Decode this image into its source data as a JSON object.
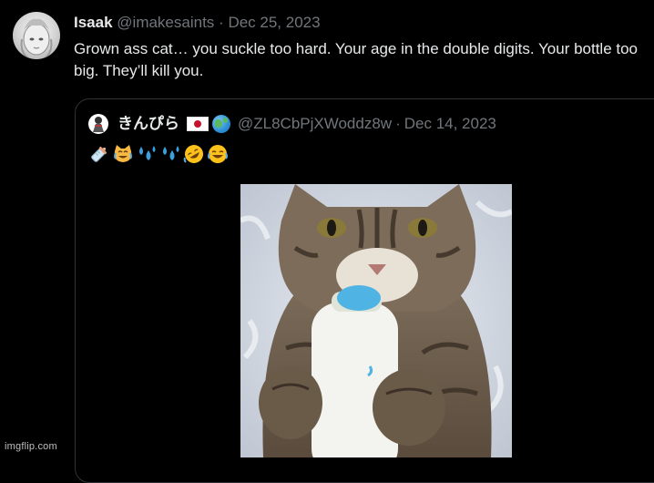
{
  "tweet": {
    "author_name": "Isaak",
    "handle": "@imakesaints",
    "separator": "·",
    "date": "Dec 25, 2023",
    "text": "Grown ass cat… you suckle too hard. Your age in the double digits. Your bottle too big. They’ll kill you."
  },
  "quoted_tweet": {
    "author_name": "きんぴら",
    "handle": "@ZL8CbPjXWoddz8w",
    "separator": "·",
    "date": "Dec 14, 2023",
    "emojis": [
      "baby-bottle",
      "joy-cat",
      "sweat-droplets",
      "sweat-droplets",
      "rofl",
      "joy"
    ],
    "media_description_icon": "cat-drinking-from-bottle-photo"
  },
  "watermark": "imgflip.com"
}
